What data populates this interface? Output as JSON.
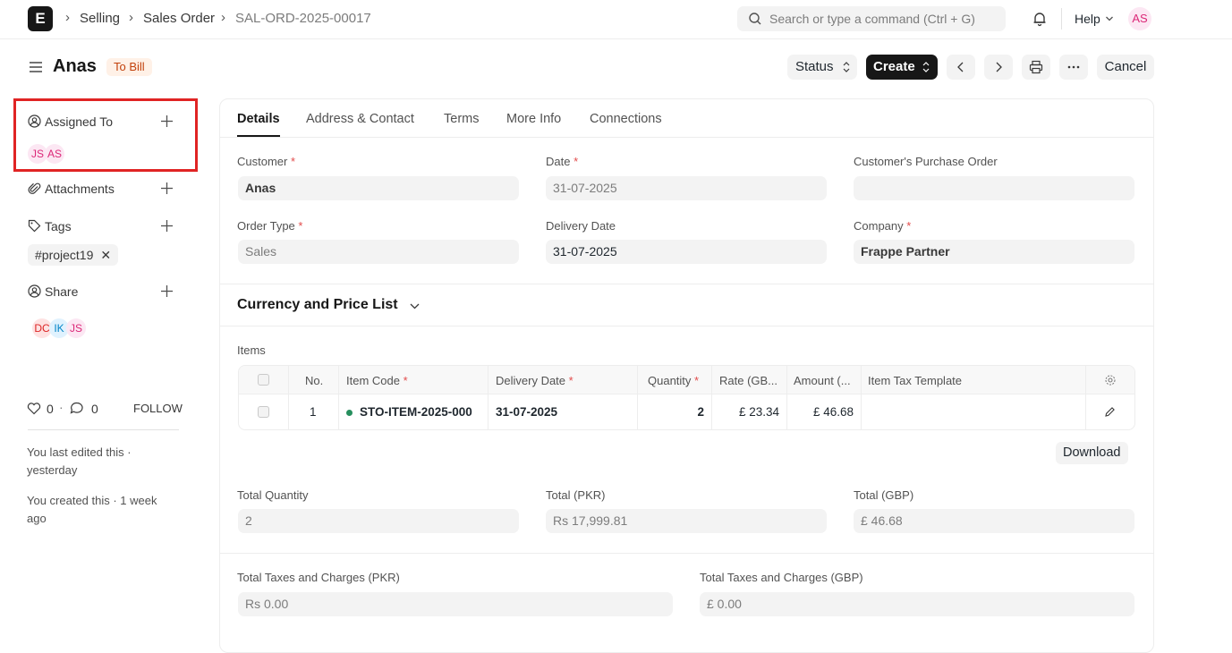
{
  "navbar": {
    "logo": "E",
    "breadcrumbs": [
      "Selling",
      "Sales Order",
      "SAL-ORD-2025-00017"
    ],
    "search_placeholder": "Search or type a command (Ctrl + G)",
    "help_label": "Help",
    "user_initials": "AS"
  },
  "page": {
    "title": "Anas",
    "status": "To Bill",
    "buttons": {
      "status": "Status",
      "create": "Create",
      "cancel": "Cancel"
    }
  },
  "sidebar": {
    "assigned_to": {
      "label": "Assigned To",
      "users": [
        "JS",
        "AS"
      ]
    },
    "attachments": {
      "label": "Attachments"
    },
    "tags": {
      "label": "Tags",
      "items": [
        "#project19"
      ]
    },
    "share": {
      "label": "Share",
      "users": [
        "DC",
        "IK",
        "JS"
      ]
    },
    "likes": "0",
    "comments": "0",
    "follow": "FOLLOW",
    "last_edited": "You last edited this · yesterday",
    "created": "You created this · 1 week ago"
  },
  "tabs": [
    "Details",
    "Address & Contact",
    "Terms",
    "More Info",
    "Connections"
  ],
  "fields": {
    "customer": {
      "label": "Customer",
      "value": "Anas"
    },
    "date": {
      "label": "Date",
      "value": "31-07-2025"
    },
    "customer_po": {
      "label": "Customer's Purchase Order",
      "value": ""
    },
    "order_type": {
      "label": "Order Type",
      "value": "Sales"
    },
    "delivery_date": {
      "label": "Delivery Date",
      "value": "31-07-2025"
    },
    "company": {
      "label": "Company",
      "value": "Frappe Partner"
    }
  },
  "currency_section": {
    "title": "Currency and Price List"
  },
  "items": {
    "label": "Items",
    "columns": [
      "No.",
      "Item Code",
      "Delivery Date",
      "Quantity",
      "Rate (GB...",
      "Amount (...",
      "Item Tax Template"
    ],
    "rows": [
      {
        "no": "1",
        "item_code": "STO-ITEM-2025-000",
        "delivery_date": "31-07-2025",
        "quantity": "2",
        "rate": "£ 23.34",
        "amount": "£ 46.68",
        "tax_template": ""
      }
    ],
    "download_label": "Download"
  },
  "totals": {
    "total_quantity": {
      "label": "Total Quantity",
      "value": "2"
    },
    "total_pkr": {
      "label": "Total (PKR)",
      "value": "Rs 17,999.81"
    },
    "total_gbp": {
      "label": "Total (GBP)",
      "value": "£ 46.68"
    },
    "taxes_pkr": {
      "label": "Total Taxes and Charges (PKR)",
      "value": "Rs 0.00"
    },
    "taxes_gbp": {
      "label": "Total Taxes and Charges (GBP)",
      "value": "£ 0.00"
    }
  },
  "colors": {
    "accent_dark": "#171717",
    "status_badge_bg": "#fff1e7",
    "status_badge_fg": "#c2410c",
    "highlight_box": "#e02424"
  }
}
